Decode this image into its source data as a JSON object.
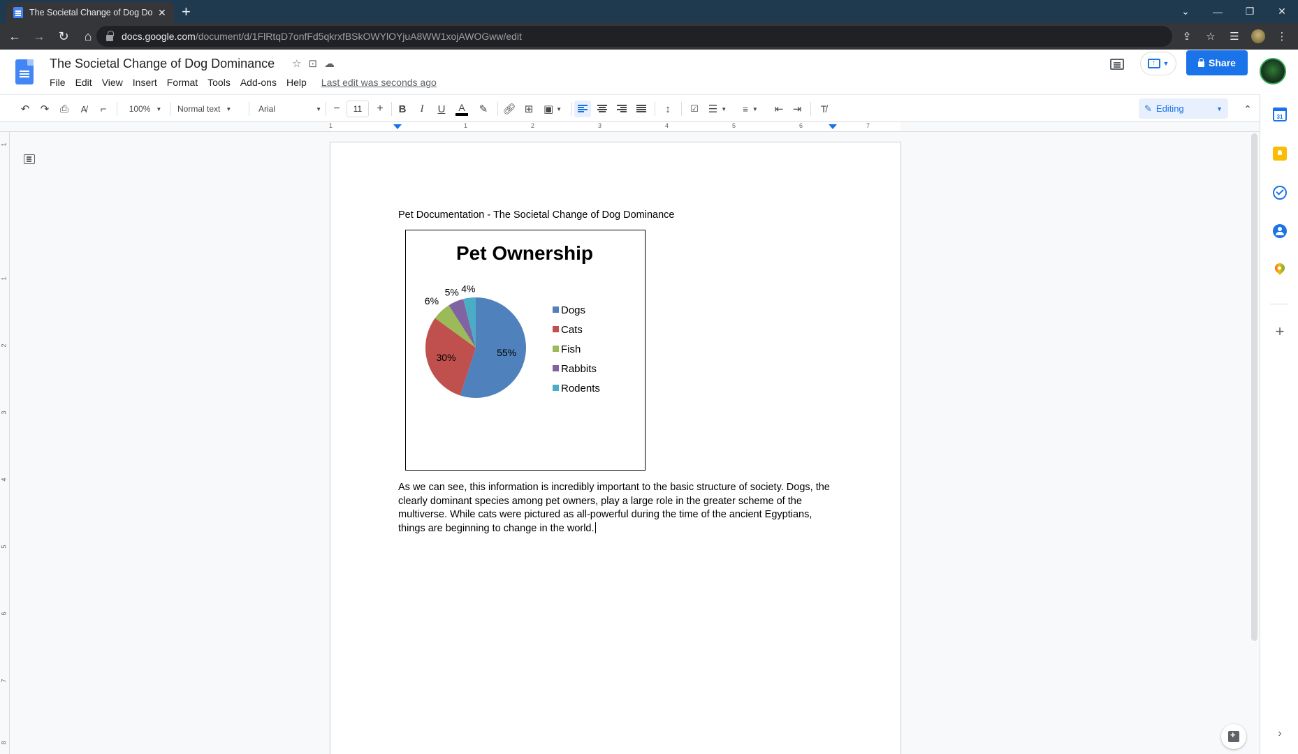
{
  "browser": {
    "tab_title": "The Societal Change of Dog Dominance",
    "url_host": "docs.google.com",
    "url_path": "/document/d/1FlRtqD7onfFd5qkrxfBSkOWYlOYjuA8WW1xojAWOGww/edit"
  },
  "docs": {
    "title": "The Societal Change of Dog Dominance",
    "menu": [
      "File",
      "Edit",
      "View",
      "Insert",
      "Format",
      "Tools",
      "Add-ons",
      "Help"
    ],
    "last_edit": "Last edit was seconds ago",
    "share_label": "Share"
  },
  "toolbar": {
    "zoom": "100%",
    "style": "Normal text",
    "font": "Arial",
    "font_size": "11",
    "mode": "Editing"
  },
  "ruler": {
    "numbers": [
      "1",
      "1",
      "2",
      "3",
      "4",
      "5",
      "6",
      "7"
    ]
  },
  "vruler": {
    "numbers": [
      "1",
      "1",
      "2",
      "3",
      "4",
      "5",
      "6",
      "7",
      "8"
    ]
  },
  "document": {
    "heading": "Pet Documentation - The Societal Change of Dog Dominance",
    "paragraph": "As we can see, this information is incredibly important to the basic structure of society. Dogs, the clearly dominant species among pet owners, play a large role in the greater scheme of the multiverse. While cats were pictured as all-powerful during the time of the ancient Egyptians, things are beginning to change in the world."
  },
  "chart_data": {
    "type": "pie",
    "title": "Pet Ownership",
    "categories": [
      "Dogs",
      "Cats",
      "Fish",
      "Rabbits",
      "Rodents"
    ],
    "values": [
      55,
      30,
      6,
      5,
      4
    ],
    "labels": [
      "55%",
      "30%",
      "6%",
      "5%",
      "4%"
    ],
    "colors": [
      "#4f81bd",
      "#c0504d",
      "#9bbb59",
      "#8064a2",
      "#4bacc6"
    ],
    "legend": "right"
  }
}
